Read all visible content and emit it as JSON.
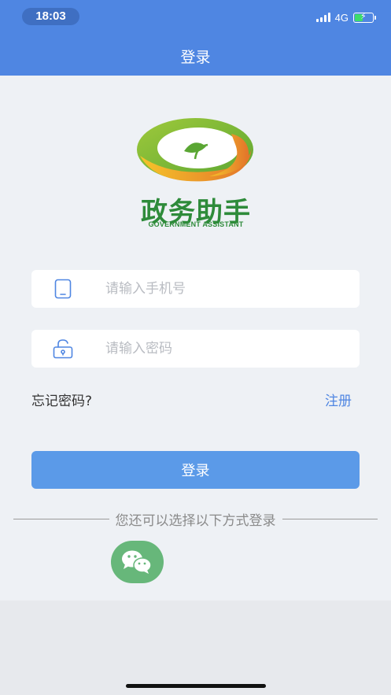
{
  "status_bar": {
    "time": "18:03",
    "network": "4G"
  },
  "header": {
    "title": "登录"
  },
  "logo": {
    "name_cn": "政务助手",
    "name_en": "GOVERNMENT ASSISTANT"
  },
  "form": {
    "phone_placeholder": "请输入手机号",
    "password_placeholder": "请输入密码",
    "forgot_label": "忘记密码?",
    "register_label": "注册",
    "login_label": "登录"
  },
  "alt_login": {
    "text": "您还可以选择以下方式登录",
    "options": [
      "wechat"
    ]
  },
  "colors": {
    "primary": "#4f86e2",
    "button": "#5b9ae8",
    "brand_green": "#2e8b3a",
    "wechat": "#67b77a"
  }
}
